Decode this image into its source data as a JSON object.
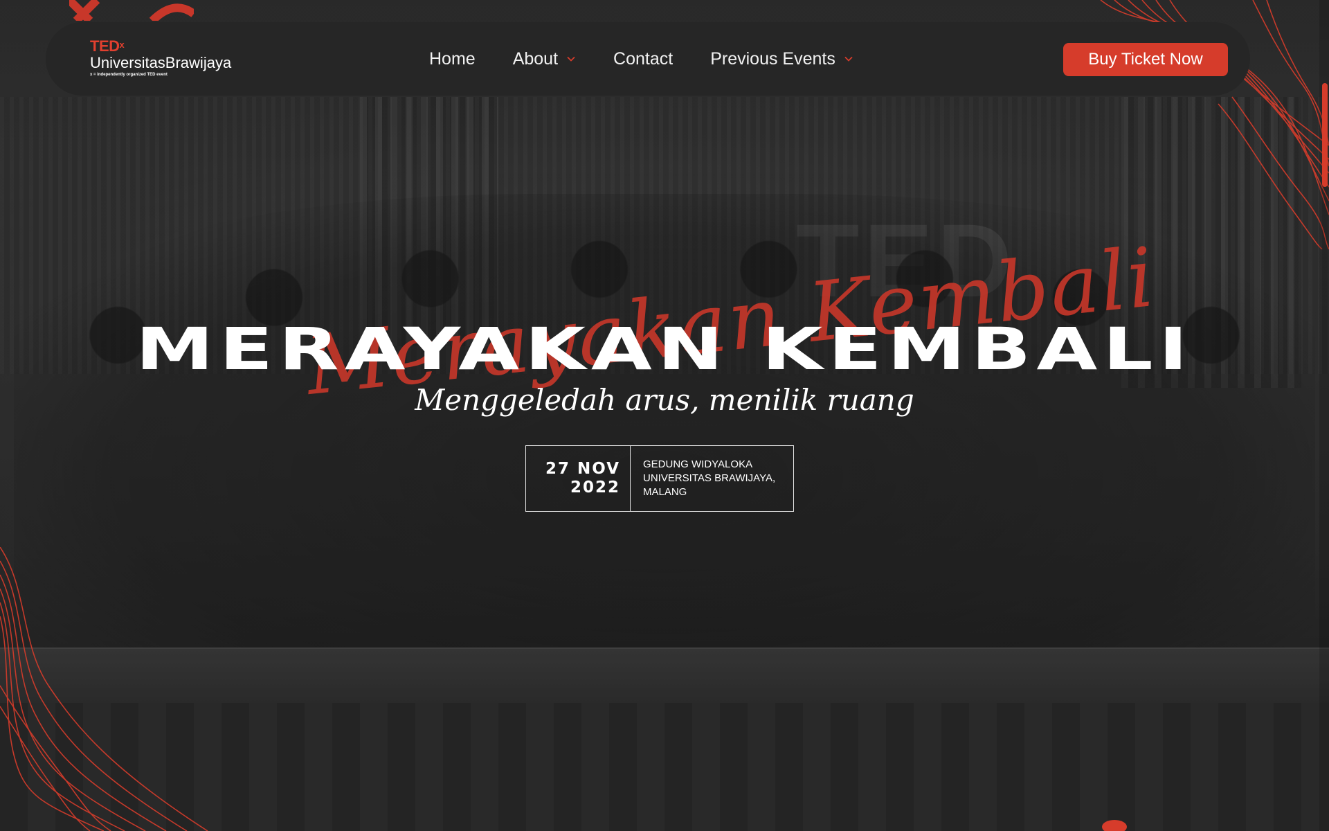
{
  "logo": {
    "brand": "TED",
    "superscript": "x",
    "name": "UniversitasBrawijaya",
    "tagline": "x = independently organized TED event"
  },
  "nav": {
    "items": [
      {
        "label": "Home",
        "has_dropdown": false
      },
      {
        "label": "About",
        "has_dropdown": true
      },
      {
        "label": "Contact",
        "has_dropdown": false
      },
      {
        "label": "Previous Events",
        "has_dropdown": true
      }
    ],
    "cta_label": "Buy Ticket Now"
  },
  "hero": {
    "script_text": "Merayakan Kembali",
    "title": "MERAYAKAN KEMBALI",
    "subtitle": "Menggeledah arus, menilik ruang",
    "date_line1": "27 NOV",
    "date_line2": "2022",
    "venue_line1": "GEDUNG WIDYALOKA",
    "venue_line2": "UNIVERSITAS BRAWIJAYA,",
    "venue_line3": "MALANG"
  },
  "icons": {
    "dropdown": "chevron-down-icon"
  },
  "colors": {
    "accent": "#d63c2b",
    "navbar": "#262626",
    "text": "#ffffff"
  }
}
